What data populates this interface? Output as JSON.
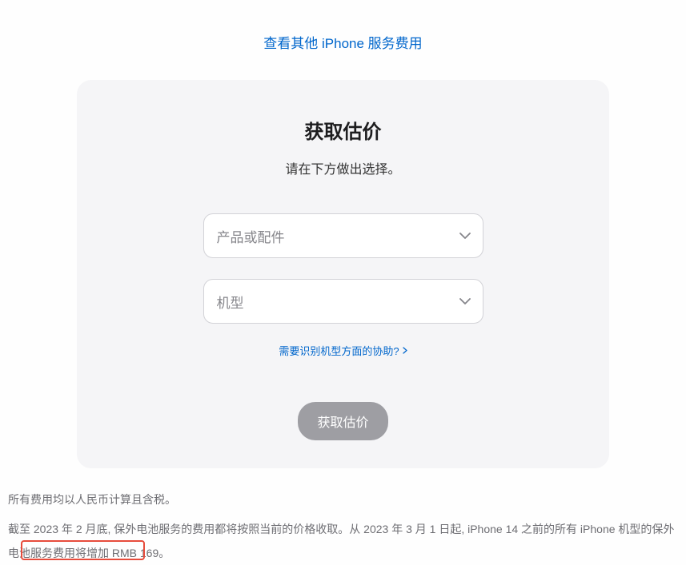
{
  "topLink": {
    "label": "查看其他 iPhone 服务费用"
  },
  "card": {
    "title": "获取估价",
    "subtitle": "请在下方做出选择。",
    "selectProduct": {
      "placeholder": "产品或配件"
    },
    "selectModel": {
      "placeholder": "机型"
    },
    "helpLink": {
      "label": "需要识别机型方面的协助?"
    },
    "submitButton": {
      "label": "获取估价"
    }
  },
  "footer": {
    "line1": "所有费用均以人民币计算且含税。",
    "line2_part1": "截至 2023 年 2 月底, 保外电池服务的费用都将按照当前的价格收取。从 2023 年 3 月 1 日起, iPhone 14 之前的所有 iPhone 机型的保外电池服务",
    "line2_highlight": "费用将增加 RMB 169。"
  }
}
